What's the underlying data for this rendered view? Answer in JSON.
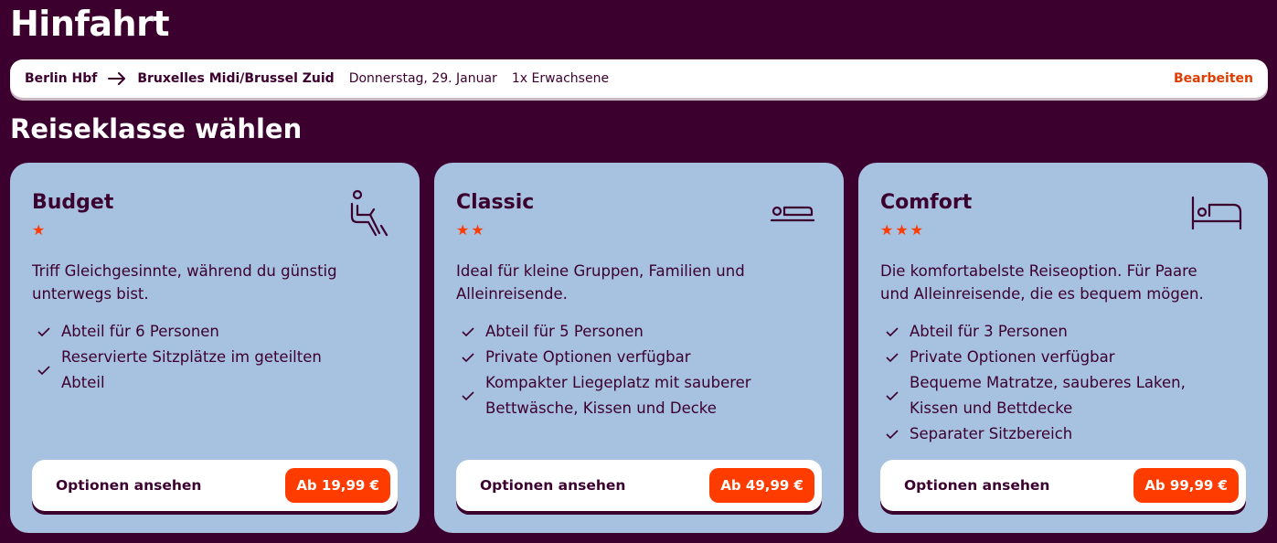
{
  "page": {
    "title": "Hinfahrt"
  },
  "journey": {
    "from": "Berlin Hbf",
    "to": "Bruxelles Midi/Brussel Zuid",
    "date": "Donnerstag, 29. Januar",
    "passengers": "1x Erwachsene",
    "edit_label": "Bearbeiten"
  },
  "section": {
    "title": "Reiseklasse wählen"
  },
  "colors": {
    "background": "#3c002e",
    "card": "#a7c1e0",
    "accent": "#ff3c00",
    "edit_link": "#e03c00"
  },
  "cards": [
    {
      "name": "Budget",
      "stars": "★",
      "icon": "seat-icon",
      "description": "Triff Gleichgesinnte, während du günstig unterwegs bist.",
      "features": [
        "Abteil für 6 Personen",
        "Reservierte Sitzplätze im geteilten Abteil"
      ],
      "cta_label": "Optionen ansehen",
      "price": "Ab 19,99 €"
    },
    {
      "name": "Classic",
      "stars": "★★",
      "icon": "couchette-icon",
      "description": "Ideal für kleine Gruppen, Familien und Alleinreisende.",
      "features": [
        "Abteil für 5 Personen",
        "Private Optionen verfügbar",
        "Kompakter Liegeplatz mit sauberer Bettwäsche, Kissen und Decke"
      ],
      "cta_label": "Optionen ansehen",
      "price": "Ab 49,99 €"
    },
    {
      "name": "Comfort",
      "stars": "★★★",
      "icon": "bed-icon",
      "description": "Die komfortabelste Reiseoption. Für Paare und Alleinreisende, die es bequem mögen.",
      "features": [
        "Abteil für 3 Personen",
        "Private Optionen verfügbar",
        "Bequeme Matratze, sauberes Laken, Kissen und Bettdecke",
        "Separater Sitzbereich"
      ],
      "cta_label": "Optionen ansehen",
      "price": "Ab 99,99 €"
    }
  ]
}
